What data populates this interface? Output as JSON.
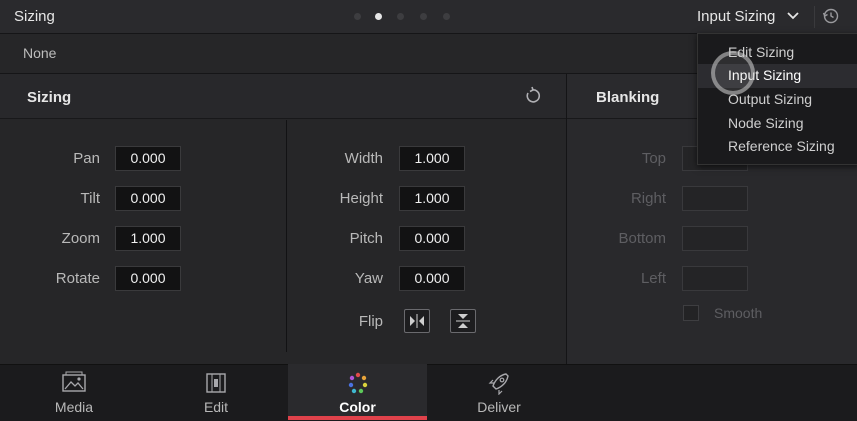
{
  "header": {
    "title": "Sizing",
    "page_dots": 5,
    "active_dot": 2,
    "mode": "Input Sizing"
  },
  "preset": {
    "value": "None"
  },
  "sizing": {
    "title": "Sizing",
    "left_fields": [
      {
        "label": "Pan",
        "value": "0.000"
      },
      {
        "label": "Tilt",
        "value": "0.000"
      },
      {
        "label": "Zoom",
        "value": "1.000"
      },
      {
        "label": "Rotate",
        "value": "0.000"
      }
    ],
    "right_fields": [
      {
        "label": "Width",
        "value": "1.000"
      },
      {
        "label": "Height",
        "value": "1.000"
      },
      {
        "label": "Pitch",
        "value": "0.000"
      },
      {
        "label": "Yaw",
        "value": "0.000"
      }
    ],
    "flip_label": "Flip"
  },
  "blanking": {
    "title": "Blanking",
    "fields": [
      {
        "label": "Top",
        "value": ""
      },
      {
        "label": "Right",
        "value": ""
      },
      {
        "label": "Bottom",
        "value": ""
      },
      {
        "label": "Left",
        "value": ""
      }
    ],
    "smooth_label": "Smooth"
  },
  "dropdown": {
    "items": [
      "Edit Sizing",
      "Input Sizing",
      "Output Sizing",
      "Node Sizing",
      "Reference Sizing"
    ],
    "highlighted": "Input Sizing"
  },
  "nav": {
    "items": [
      {
        "label": "Media",
        "icon": "media-icon"
      },
      {
        "label": "Edit",
        "icon": "edit-icon"
      },
      {
        "label": "Color",
        "icon": "color-icon"
      },
      {
        "label": "Deliver",
        "icon": "deliver-icon"
      }
    ],
    "active": "Color",
    "accent": "#e0424b"
  }
}
